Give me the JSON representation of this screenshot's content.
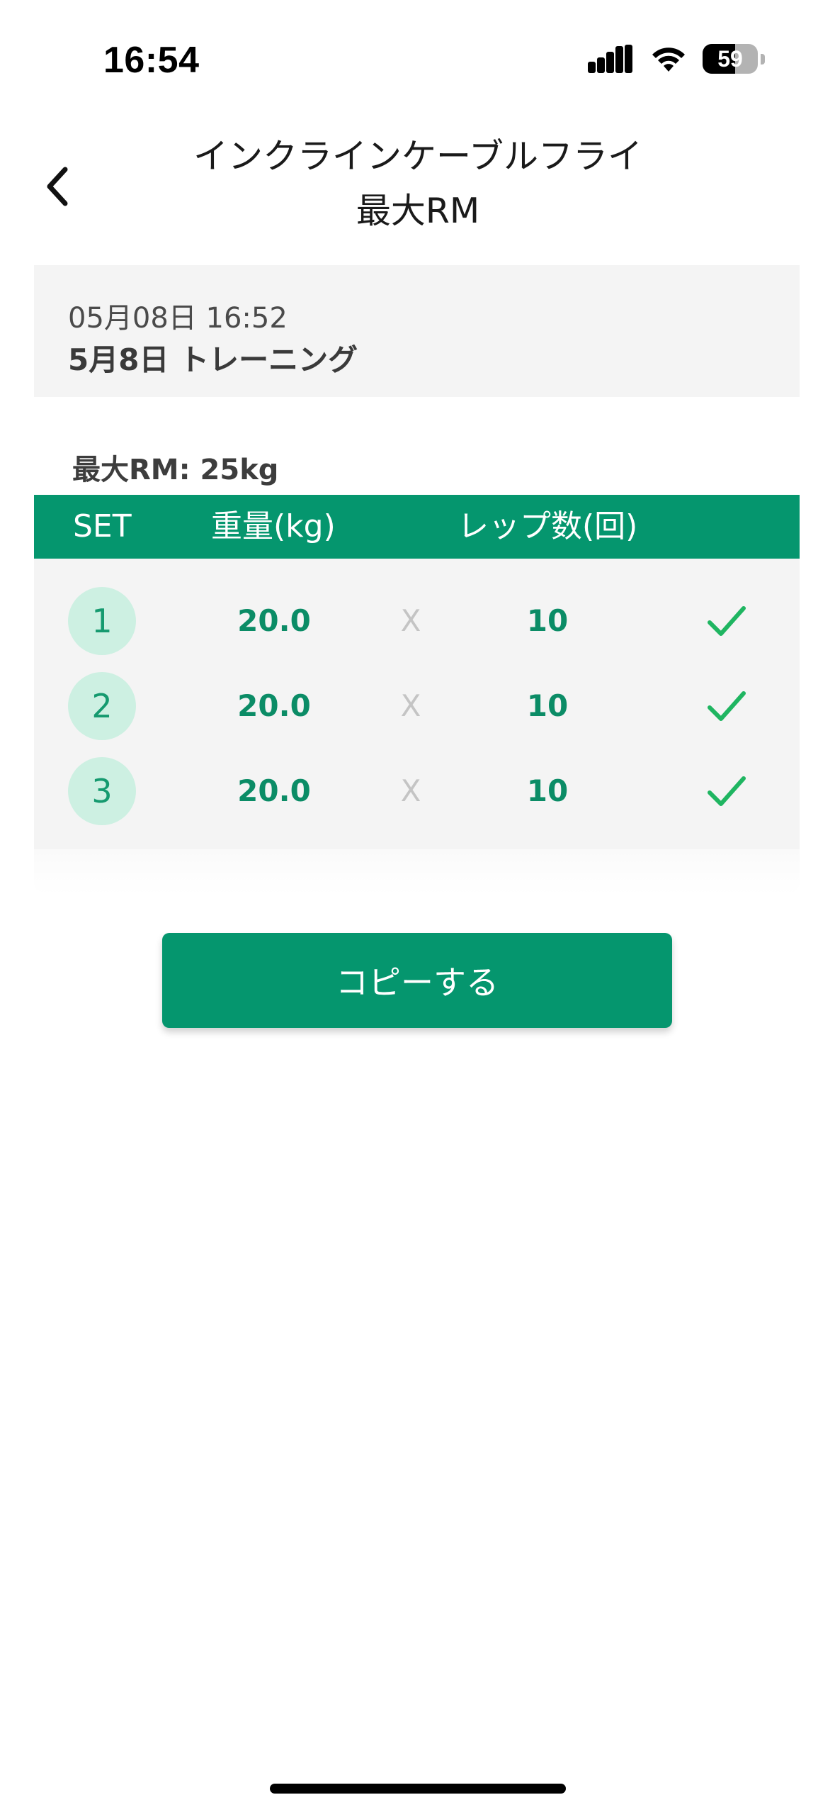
{
  "status_bar": {
    "time": "16:54",
    "battery_level": "59",
    "icons": [
      "cellular-signal-icon",
      "wifi-icon",
      "battery-icon"
    ]
  },
  "header": {
    "back_icon": "chevron-left-icon",
    "title_line1": "インクラインケーブルフライ",
    "title_line2": "最大RM"
  },
  "session": {
    "datetime": "05月08日 16:52",
    "name": "5月8日 トレーニング"
  },
  "max_rm": "最大RM: 25kg",
  "table": {
    "headers": {
      "set": "SET",
      "weight": "重量(kg)",
      "reps": "レップ数(回)"
    },
    "times_symbol": "X",
    "rows": [
      {
        "set": "1",
        "weight": "20.0",
        "reps": "10",
        "completed": true
      },
      {
        "set": "2",
        "weight": "20.0",
        "reps": "10",
        "completed": true
      },
      {
        "set": "3",
        "weight": "20.0",
        "reps": "10",
        "completed": true
      }
    ]
  },
  "copy_button": {
    "label": "コピーする"
  },
  "colors": {
    "accent": "#05966e",
    "badge_bg": "#cdf0e2",
    "check": "#1fb561",
    "card_bg": "#f4f4f4"
  }
}
